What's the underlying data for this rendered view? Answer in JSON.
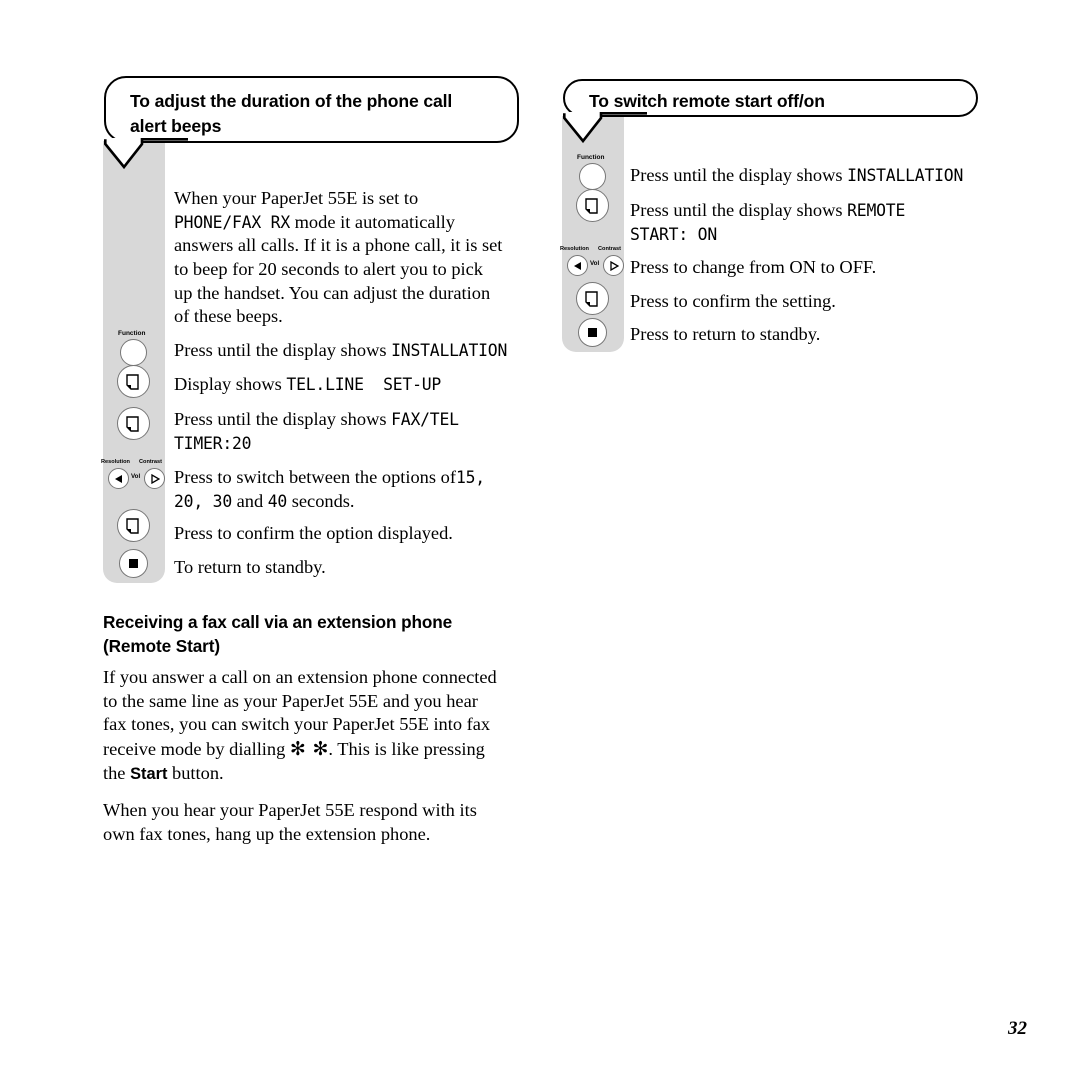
{
  "page": {
    "folio": "32"
  },
  "left_column": {
    "callout_title_line1": "To adjust the duration of the phone call",
    "callout_title_line2": "alert beeps",
    "intro": {
      "line1_pre": "When your PaperJet 55E is set to",
      "line2_lcd": "PHONE/FAX RX",
      "line2_post": " mode it automatically",
      "line3": "answers all calls. If it is a phone call, it is set",
      "line4": "to beep for 20 seconds to alert you to pick",
      "line5": "up the handset. You can adjust the duration",
      "line6": "of these beeps."
    },
    "steps": [
      {
        "icon": "function-button",
        "icon_label": "Function",
        "text_pre": "Press until the display shows ",
        "text_lcd": "INSTALLATION",
        "text_post": ""
      },
      {
        "icon": "page-button",
        "icon_label": "",
        "text_pre": "Display shows ",
        "text_lcd": "TEL.LINE  SET-UP",
        "text_post": ""
      },
      {
        "icon": "page-button",
        "icon_label": "",
        "text_pre": "Press until the display shows ",
        "text_lcd": "FAX/TEL",
        "text_post": "",
        "text_line2_lcd": "TIMER:20"
      },
      {
        "icon": "arrow-pair",
        "icon_label_left": "Resolution",
        "icon_label_right": "Contrast",
        "icon_label_mid": "Vol",
        "text_pre": "Press to switch between the options of",
        "text_lcd": "15,",
        "text_line2_lcd": "20, 30",
        "text_line2_mid": " and ",
        "text_line2_lcd2": "40",
        "text_line2_post": " seconds."
      },
      {
        "icon": "page-button",
        "icon_label": "",
        "text_pre": "Press to confirm the option displayed.",
        "text_lcd": "",
        "text_post": ""
      },
      {
        "icon": "stop-button",
        "icon_label": "",
        "text_pre": "To return to standby.",
        "text_lcd": "",
        "text_post": ""
      }
    ],
    "subhead_line1": "Receiving a fax call via an extension phone",
    "subhead_line2": "(Remote Start)",
    "para1": {
      "line1": "If you answer a call on an extension phone connected",
      "line2": "to the same line as your PaperJet 55E and you hear",
      "line3": "fax tones, you can switch your PaperJet 55E into fax",
      "line4_pre": "receive mode by dialling ",
      "line4_stars": "✻ ✻",
      "line4_post": ". This is like pressing",
      "line5_pre": "the ",
      "line5_bold": "Start",
      "line5_post": " button."
    },
    "para2": {
      "line1": "When you hear your PaperJet 55E respond with its",
      "line2": "own fax tones, hang up the extension phone."
    }
  },
  "right_column": {
    "callout_title": "To switch remote start off/on",
    "steps": [
      {
        "icon": "function-button",
        "icon_label": "Function",
        "text_pre": "Press until the display shows ",
        "text_lcd": "INSTALLATION",
        "text_post": ""
      },
      {
        "icon": "page-button",
        "icon_label": "",
        "text_pre": "Press until the display shows ",
        "text_lcd": "REMOTE",
        "text_post": "",
        "text_line2_lcd": "START: ON"
      },
      {
        "icon": "arrow-pair",
        "icon_label_left": "Resolution",
        "icon_label_right": "Contrast",
        "icon_label_mid": "Vol",
        "text_pre": "Press to change from ON to OFF.",
        "text_lcd": "",
        "text_post": ""
      },
      {
        "icon": "page-button",
        "icon_label": "",
        "text_pre": "Press to confirm the setting.",
        "text_lcd": "",
        "text_post": ""
      },
      {
        "icon": "stop-button",
        "icon_label": "",
        "text_pre": "Press to return to standby.",
        "text_lcd": "",
        "text_post": ""
      }
    ]
  },
  "colors": {
    "panel_grey": "#d8d8d8",
    "ink": "#000000",
    "paper": "#ffffff"
  }
}
